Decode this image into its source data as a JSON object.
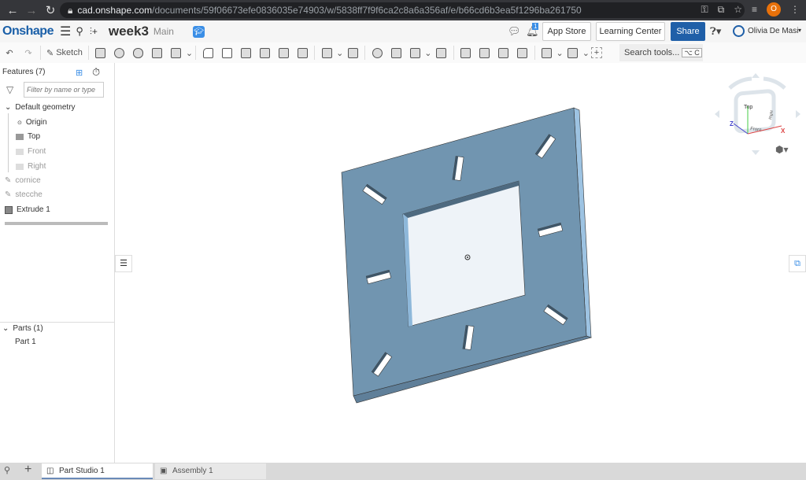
{
  "browser": {
    "url_host": "cad.onshape.com",
    "url_path": "/documents/59f06673efe0836035e74903/w/5838ff7f9f6ca2c8a6a356af/e/b66cd6b3ea5f1296ba261750",
    "profile_initial": "O"
  },
  "header": {
    "logo": "Onshape",
    "document_title": "week3",
    "branch": "Main",
    "notification_count": "1",
    "app_store": "App Store",
    "learning_center": "Learning Center",
    "share": "Share",
    "user": "Olivia De Masi"
  },
  "toolbar": {
    "sketch": "Sketch",
    "search_placeholder": "Search tools...",
    "search_shortcut": "⌥ C"
  },
  "features": {
    "title": "Features (7)",
    "filter_placeholder": "Filter by name or type",
    "group": "Default geometry",
    "items": [
      "Origin",
      "Top",
      "Front",
      "Right",
      "cornice",
      "stecche",
      "Extrude 1"
    ]
  },
  "parts": {
    "title": "Parts (1)",
    "items": [
      "Part 1"
    ]
  },
  "viewcube": {
    "top": "Top",
    "front": "Front",
    "right": "Right",
    "x": "X",
    "z": "Z"
  },
  "tabs": [
    {
      "label": "Part Studio 1",
      "active": true
    },
    {
      "label": "Assembly 1",
      "active": false
    }
  ],
  "colors": {
    "part": "#7195b0",
    "brand": "#1a5fa8",
    "share": "#1f5fa8"
  }
}
